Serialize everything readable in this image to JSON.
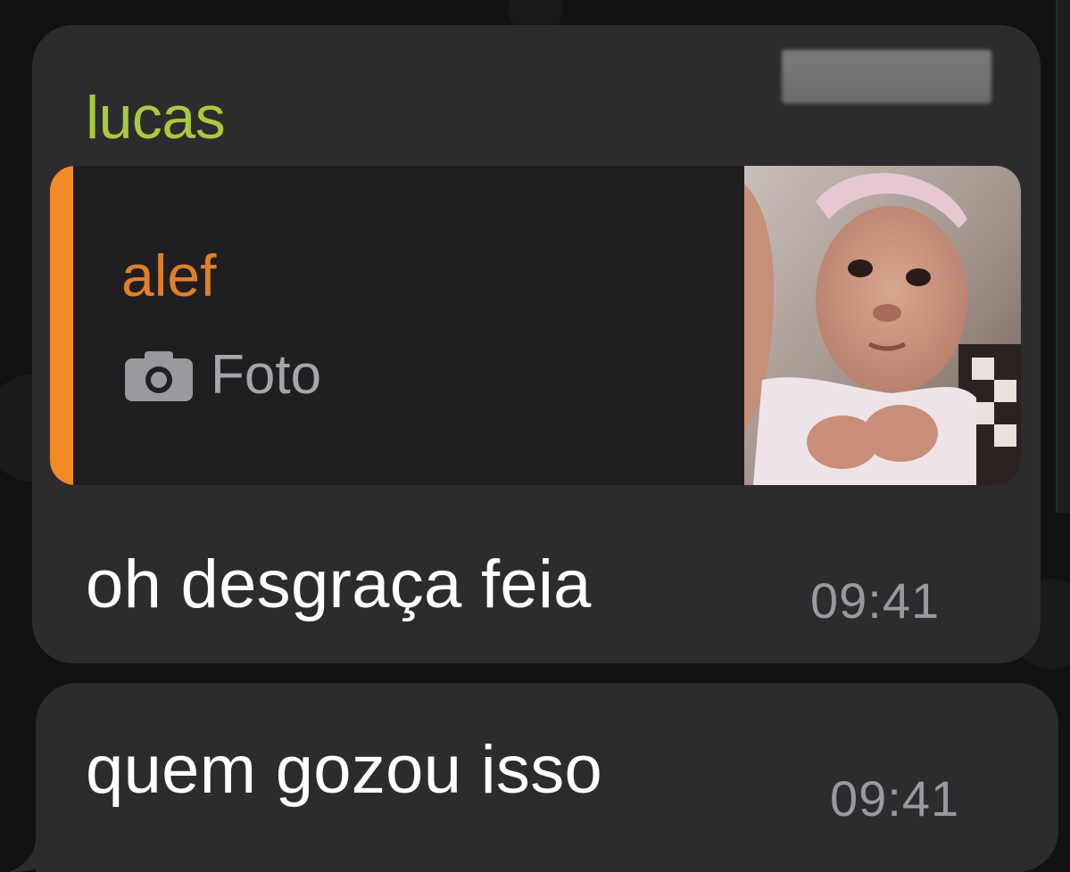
{
  "chat": {
    "messages": [
      {
        "sender": "lucas",
        "sender_color": "#a9c93f",
        "reply_to": {
          "sender": "alef",
          "sender_color": "#e07f2a",
          "caption_icon": "camera-icon",
          "caption": "Foto",
          "accent_color": "#f08a24"
        },
        "text": "oh desgraça feia",
        "time": "09:41"
      },
      {
        "text": "quem gozou isso",
        "time": "09:41"
      }
    ]
  },
  "colors": {
    "bubble": "#2c2c2e",
    "quote_background": "#1f1f21",
    "background": "#121212"
  }
}
